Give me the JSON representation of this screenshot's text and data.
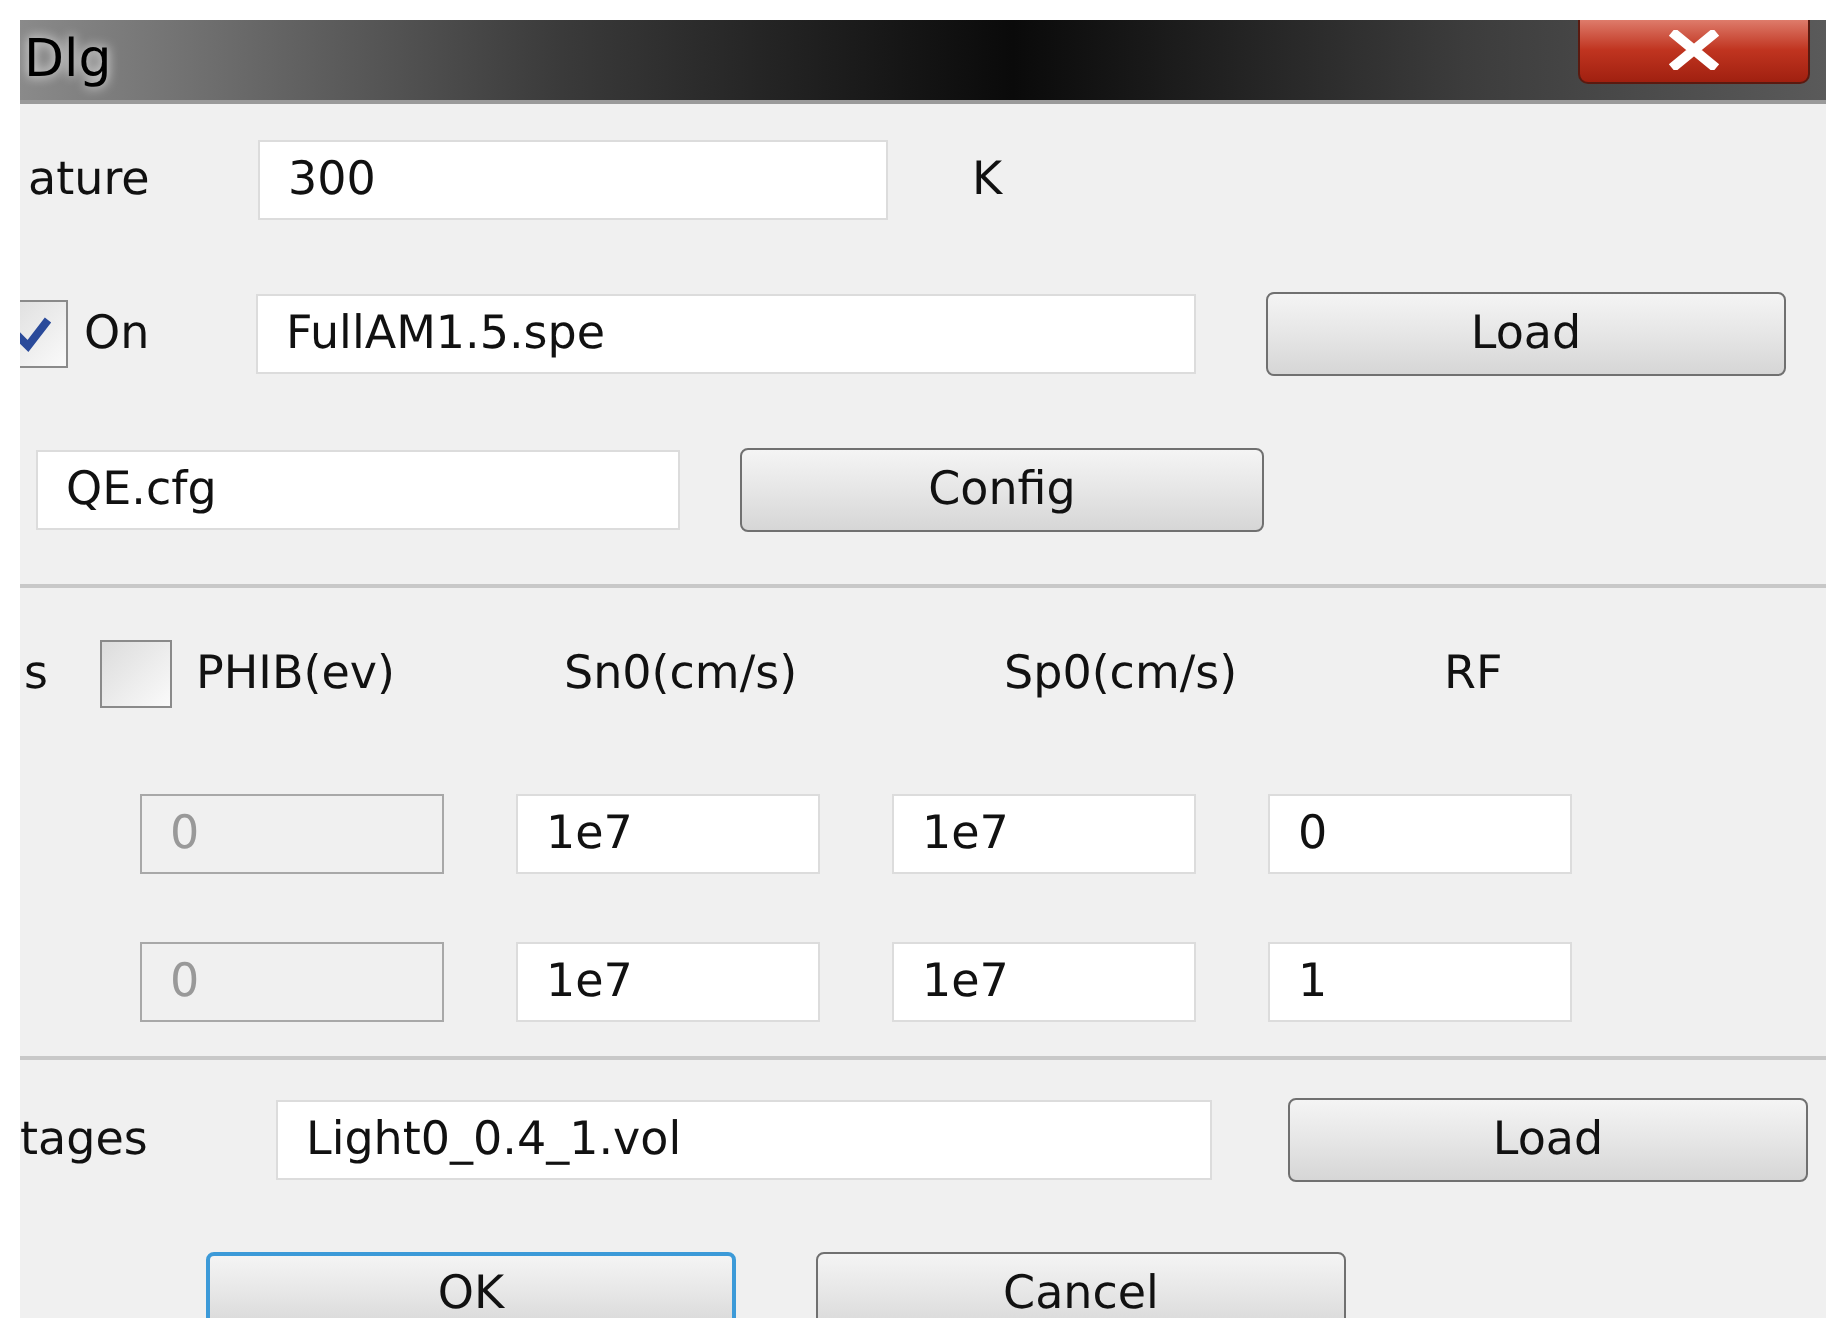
{
  "window": {
    "title": "Dlg"
  },
  "temperature": {
    "label": "ature",
    "value": "300",
    "unit": "K"
  },
  "spectrum": {
    "checked": true,
    "label": "On",
    "value": "FullAM1.5.spe",
    "button": "Load"
  },
  "qe": {
    "value": "QE.cfg",
    "button": "Config"
  },
  "contacts": {
    "label": "s",
    "phib_checked": false,
    "phib_label": "PHIB(ev)",
    "headers": [
      "Sn0(cm/s)",
      "Sp0(cm/s)",
      "RF"
    ],
    "rows": [
      {
        "cells": [
          {
            "value": "0",
            "disabled": true
          },
          {
            "value": "1e7",
            "disabled": false
          },
          {
            "value": "1e7",
            "disabled": false
          },
          {
            "value": "0",
            "disabled": false
          }
        ]
      },
      {
        "cells": [
          {
            "value": "0",
            "disabled": true
          },
          {
            "value": "1e7",
            "disabled": false
          },
          {
            "value": "1e7",
            "disabled": false
          },
          {
            "value": "1",
            "disabled": false
          }
        ]
      }
    ]
  },
  "voltages": {
    "label": "tages",
    "value": "Light0_0.4_1.vol",
    "button": "Load"
  },
  "buttons": [
    {
      "label": "OK",
      "default": true
    },
    {
      "label": "Cancel",
      "default": false
    }
  ]
}
